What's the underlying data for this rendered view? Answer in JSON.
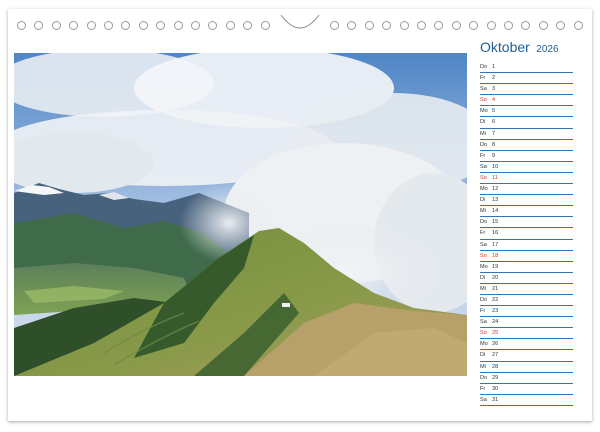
{
  "calendar": {
    "month": "Oktober",
    "year": "2026",
    "days": [
      {
        "wd": "Do",
        "d": "1",
        "sunday": false
      },
      {
        "wd": "Fr",
        "d": "2",
        "sunday": false
      },
      {
        "wd": "Sa",
        "d": "3",
        "sunday": false
      },
      {
        "wd": "So",
        "d": "4",
        "sunday": true
      },
      {
        "wd": "Mo",
        "d": "5",
        "sunday": false
      },
      {
        "wd": "Di",
        "d": "6",
        "sunday": false
      },
      {
        "wd": "Mi",
        "d": "7",
        "sunday": false
      },
      {
        "wd": "Do",
        "d": "8",
        "sunday": false
      },
      {
        "wd": "Fr",
        "d": "9",
        "sunday": false
      },
      {
        "wd": "Sa",
        "d": "10",
        "sunday": false
      },
      {
        "wd": "So",
        "d": "11",
        "sunday": true
      },
      {
        "wd": "Mo",
        "d": "12",
        "sunday": false
      },
      {
        "wd": "Di",
        "d": "13",
        "sunday": false
      },
      {
        "wd": "Mi",
        "d": "14",
        "sunday": false
      },
      {
        "wd": "Do",
        "d": "15",
        "sunday": false
      },
      {
        "wd": "Fr",
        "d": "16",
        "sunday": false
      },
      {
        "wd": "Sa",
        "d": "17",
        "sunday": false
      },
      {
        "wd": "So",
        "d": "18",
        "sunday": true
      },
      {
        "wd": "Mo",
        "d": "19",
        "sunday": false
      },
      {
        "wd": "Di",
        "d": "20",
        "sunday": false
      },
      {
        "wd": "Mi",
        "d": "21",
        "sunday": false
      },
      {
        "wd": "Do",
        "d": "22",
        "sunday": false
      },
      {
        "wd": "Fr",
        "d": "23",
        "sunday": false
      },
      {
        "wd": "Sa",
        "d": "24",
        "sunday": false
      },
      {
        "wd": "So",
        "d": "25",
        "sunday": true
      },
      {
        "wd": "Mo",
        "d": "26",
        "sunday": false
      },
      {
        "wd": "Di",
        "d": "27",
        "sunday": false
      },
      {
        "wd": "Mi",
        "d": "28",
        "sunday": false
      },
      {
        "wd": "Do",
        "d": "29",
        "sunday": false
      },
      {
        "wd": "Fr",
        "d": "30",
        "sunday": false
      },
      {
        "wd": "Sa",
        "d": "31",
        "sunday": false
      }
    ]
  },
  "colors": {
    "accent": "#1f5f95",
    "line": "#2f77b8",
    "sunday": "#d0392b"
  },
  "icons": {
    "binding": "binding-hole-icon",
    "hanger": "hanger-notch-icon"
  }
}
